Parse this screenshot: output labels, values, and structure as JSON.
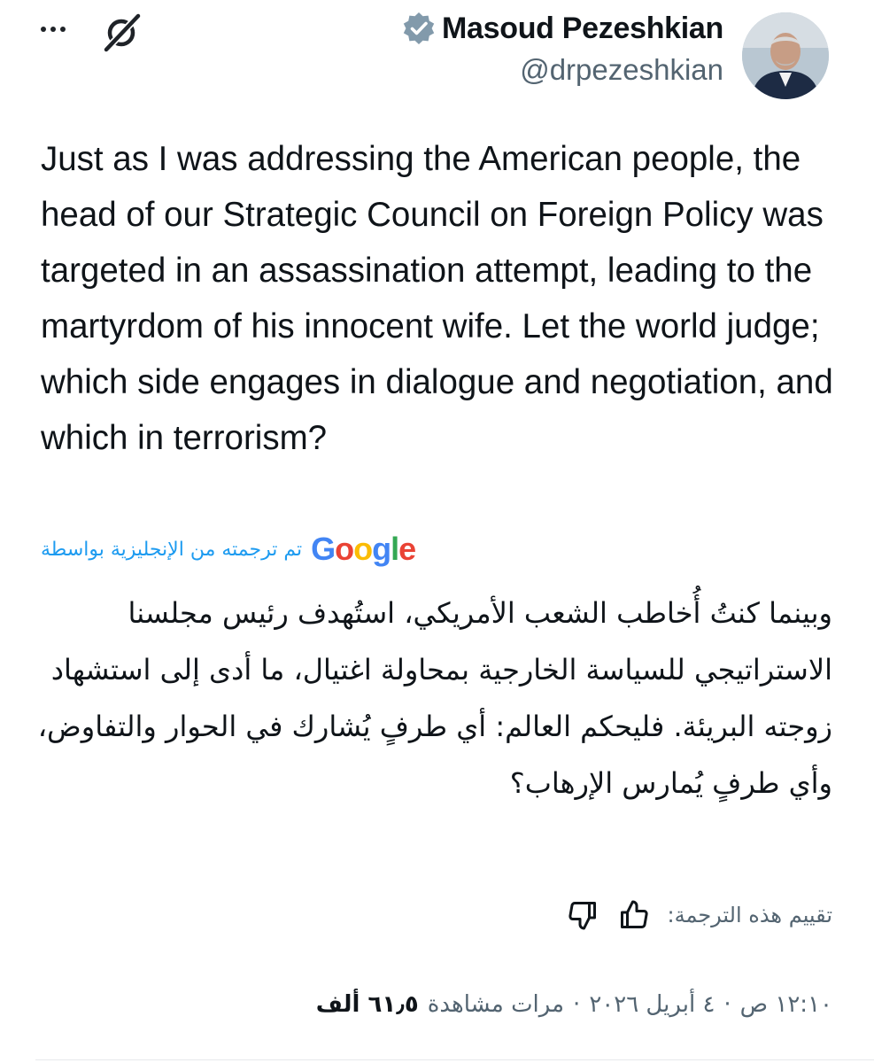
{
  "header": {
    "more_icon": "more-horizontal-icon",
    "grok_icon": "grok-icon",
    "author": {
      "name": "Masoud Pezeshkian",
      "handle": "@drpezeshkian",
      "verified_icon": "verified-badge-icon",
      "verified_color": "#829aab"
    }
  },
  "tweet": {
    "text": "Just as I was addressing the American people, the head of our Strategic Council on Foreign Policy was targeted in an assassination attempt, leading to the martyrdom of his innocent wife. Let the world judge; which side engages in dialogue and negotiation, and which in terrorism?"
  },
  "translation": {
    "label": "تم ترجمته من الإنجليزية بواسطة",
    "provider": {
      "G": "G",
      "o1": "o",
      "o2": "o",
      "g": "g",
      "l": "l",
      "e": "e"
    },
    "text": "وبينما كنتُ أُخاطب الشعب الأمريكي، استُهدف رئيس مجلسنا الاستراتيجي للسياسة الخارجية بمحاولة اغتيال، ما أدى إلى استشهاد زوجته البريئة. فليحكم العالم: أي طرفٍ يُشارك في الحوار والتفاوض، وأي طرفٍ يُمارس الإرهاب؟",
    "rate_label": "تقييم هذه الترجمة:",
    "thumb_up_icon": "thumbs-up-icon",
    "thumb_down_icon": "thumbs-down-icon"
  },
  "meta": {
    "time": "١٢:١٠ ص",
    "date": "٤ أبريل ٢٠٢٦",
    "views_count": "٦١٫٥ ألف",
    "views_label": "مرات مشاهدة",
    "separator": "·"
  },
  "colors": {
    "text_primary": "#0f1419",
    "text_secondary": "#536471",
    "link_blue": "#1d9bf0"
  }
}
